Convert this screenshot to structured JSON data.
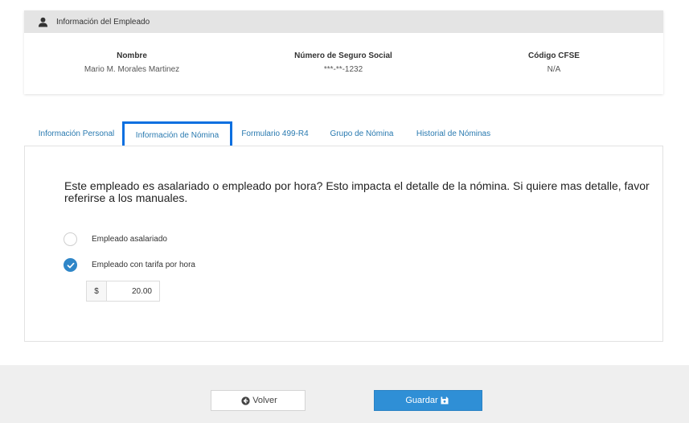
{
  "employee_card": {
    "title": "Información del Empleado",
    "icon": "user-icon",
    "name_label": "Nombre",
    "name_value": "Mario M. Morales Martinez",
    "ssn_label": "Número de Seguro Social",
    "ssn_value": "***-**-1232",
    "cfse_label": "Código CFSE",
    "cfse_value": "N/A"
  },
  "tabs": [
    {
      "label": "Información Personal",
      "active": false
    },
    {
      "label": "Información de Nómina",
      "active": true
    },
    {
      "label": "Formulario 499-R4",
      "active": false
    },
    {
      "label": "Grupo de Nómina",
      "active": false
    },
    {
      "label": "Historial de Nóminas",
      "active": false
    }
  ],
  "panel": {
    "question": "Este empleado es asalariado o empleado por hora? Esto impacta el detalle de la nómina. Si quiere mas detalle, favor referirse a los manuales.",
    "options": [
      {
        "label": "Empleado asalariado",
        "checked": false
      },
      {
        "label": "Empleado con tarifa por hora",
        "checked": true
      }
    ],
    "currency_symbol": "$",
    "rate_value": "20.00"
  },
  "footer": {
    "back_label": "Volver",
    "back_icon": "circle-arrow-left-icon",
    "save_label": "Guardar",
    "save_icon": "floppy-disk-icon"
  },
  "colors": {
    "accent": "#2f8fd6",
    "tab_text": "#2a7ab0",
    "active_tab_border": "#0a6fe0",
    "header_bg": "#e4e4e4",
    "footer_bg": "#efefef"
  }
}
